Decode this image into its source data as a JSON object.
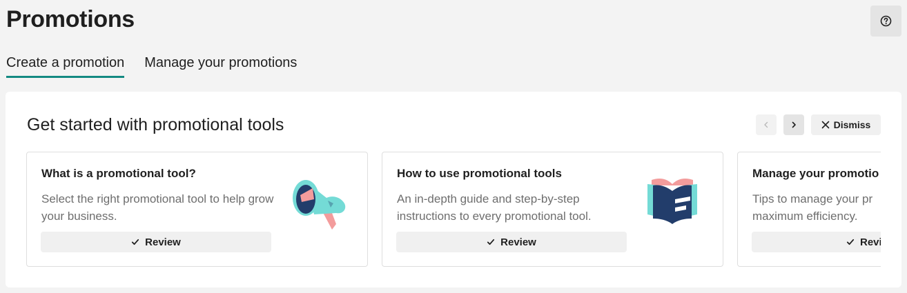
{
  "header": {
    "title": "Promotions",
    "help_icon": "question-circle-icon"
  },
  "tabs": [
    {
      "label": "Create a promotion",
      "active": true
    },
    {
      "label": "Manage your promotions",
      "active": false
    }
  ],
  "panel": {
    "title": "Get started with promotional tools",
    "prev_icon": "chevron-left-icon",
    "next_icon": "chevron-right-icon",
    "dismiss_label": "Dismiss",
    "dismiss_icon": "close-icon",
    "cards": [
      {
        "title": "What is a promotional tool?",
        "description": "Select the right promotional tool to help grow your business.",
        "button_label": "Review",
        "illustration": "megaphone-icon"
      },
      {
        "title": "How to use promotional tools",
        "description": "An in-depth guide and step-by-step instructions to every promotional tool.",
        "button_label": "Review",
        "illustration": "book-icon"
      },
      {
        "title": "Manage your promotio",
        "description": "Tips to manage your pr maximum efficiency.",
        "button_label": "Revie",
        "illustration": ""
      }
    ]
  },
  "colors": {
    "accent": "#128982",
    "teal": "#74dbd6",
    "navy": "#223d6b",
    "pink": "#f39c9c"
  }
}
